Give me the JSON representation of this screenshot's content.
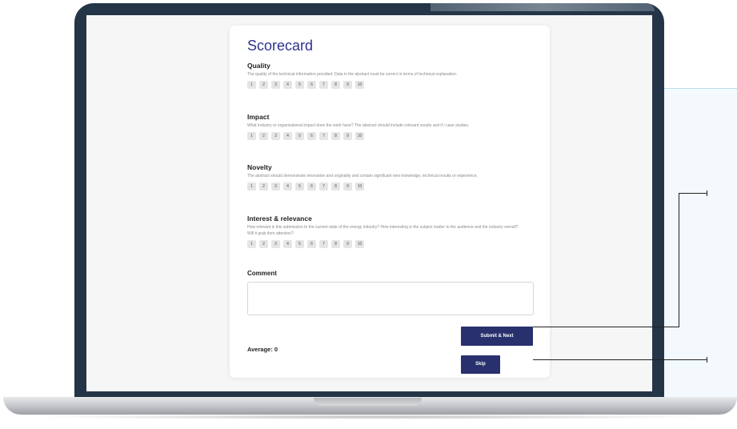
{
  "scorecard": {
    "title": "Scorecard",
    "sections": [
      {
        "title": "Quality",
        "description": "The quality of the technical information provided. Data in the abstract must be correct in terms of technical explanation.",
        "ratings": [
          "1",
          "2",
          "3",
          "4",
          "5",
          "6",
          "7",
          "8",
          "9",
          "10"
        ]
      },
      {
        "title": "Impact",
        "description": "What industry or organisational impact does the work have? The abstract should include relevant results and if / case studies.",
        "ratings": [
          "1",
          "2",
          "3",
          "4",
          "5",
          "6",
          "7",
          "8",
          "9",
          "10"
        ]
      },
      {
        "title": "Novelty",
        "description": "The abstract should demonstrate innovation and originality and contain significant new knowledge, technical results or experience.",
        "ratings": [
          "1",
          "2",
          "3",
          "4",
          "5",
          "6",
          "7",
          "8",
          "9",
          "10"
        ]
      },
      {
        "title": "Interest & relevance",
        "description": "How relevant is this submission to the current state of the energy industry? How interesting is the subject matter to the audience and the industry overall? Will it grab their attention?",
        "ratings": [
          "1",
          "2",
          "3",
          "4",
          "5",
          "6",
          "7",
          "8",
          "9",
          "10"
        ]
      }
    ],
    "comment": {
      "label": "Comment",
      "value": ""
    },
    "average": "Average: 0",
    "submit_label": "Submit & Next",
    "skip_label": "Skip"
  },
  "colors": {
    "title": "#2f3190",
    "button": "#28316e",
    "frame": "#243547",
    "rating_bg": "#e5e5e5"
  }
}
